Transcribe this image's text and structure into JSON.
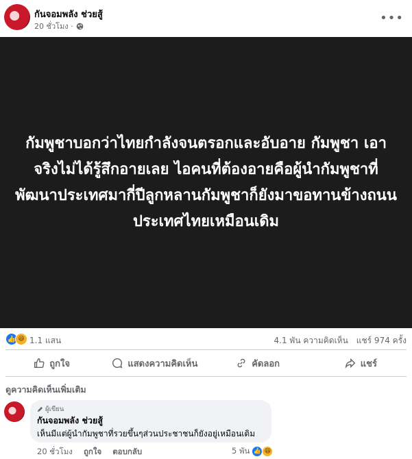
{
  "post": {
    "page_name": "กันจอมพลัง ช่วยสู้",
    "time": "20 ชั่วโมง ·",
    "image_text": "กัมพูชาบอกว่าไทยกำลังจนตรอกและอับอาย กัมพูชา เอาจริงไม่ได้รู้สึกอายเลย ไอคนที่ต้องอายคือผู้นำกัมพูชาที่พัฒนาประเทศมากี่ปีลูกหลานกัมพูชาก็ยังมาขอทานข้างถนน ประเทศไทยเหมือนเดิม"
  },
  "stats": {
    "reactions": "1.1 แสน",
    "comments": "4.1 พัน ความคิดเห็น",
    "shares": "แชร์ 974 ครั้ง"
  },
  "actions": {
    "like": "ถูกใจ",
    "comment": "แสดงความคิดเห็น",
    "copy": "คัดลอก",
    "share": "แชร์"
  },
  "comments_section": {
    "more_label": "ดูความคิดเห็นเพิ่มเติม",
    "comment": {
      "badge": "ผู้เขียน",
      "author": "กันจอมพลัง ช่วยสู้",
      "text": "เห็นมีแต่ผู้นำกัมพูชาที่รวยขึ้นๆส่วนประชาชนก็ยังอยู่เหมือนเดิม",
      "time": "20 ชั่วโมง",
      "like": "ถูกใจ",
      "reply": "ตอบกลับ",
      "reactions": "5 พัน"
    }
  },
  "icons": {
    "globe": "globe-icon",
    "more": "more-options-icon",
    "like": "thumbs-up-icon",
    "comment": "comment-icon",
    "copy": "link-icon",
    "share": "share-icon",
    "badge": "pencil-icon"
  },
  "colors": {
    "like_blue": "#1877f2",
    "haha_yellow": "#f7b125",
    "media_bg": "#1c1c1c"
  }
}
